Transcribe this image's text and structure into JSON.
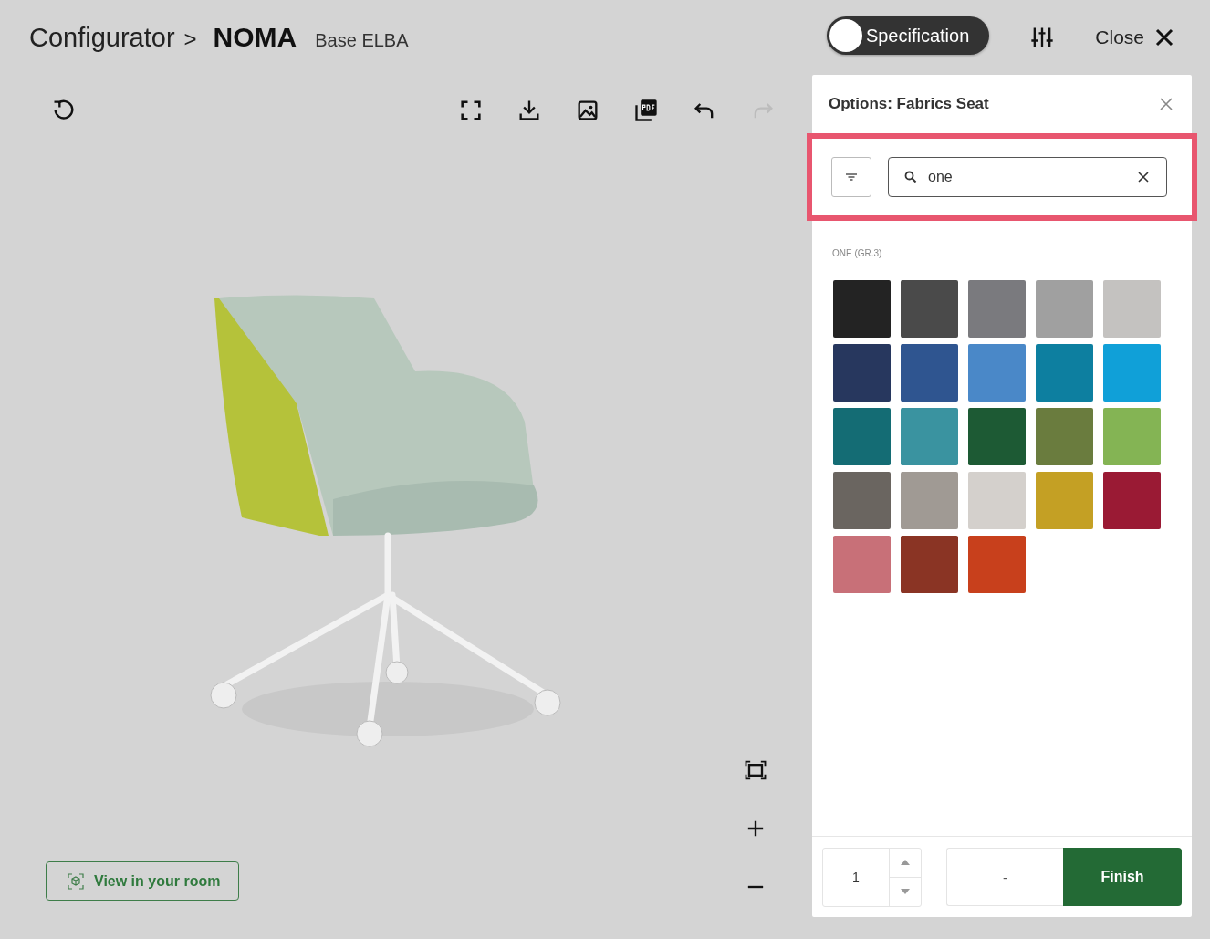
{
  "breadcrumb": {
    "root": "Configurator",
    "separator": ">",
    "product": "NOMA",
    "variant": "Base ELBA"
  },
  "header_actions": {
    "specification_toggle": {
      "label": "Specification",
      "on": false
    },
    "close_label": "Close"
  },
  "viewer_toolbar": [
    {
      "kind": "fullscreen",
      "disabled": false
    },
    {
      "kind": "download",
      "disabled": false
    },
    {
      "kind": "image",
      "disabled": false
    },
    {
      "kind": "pdf",
      "disabled": false
    },
    {
      "kind": "undo",
      "disabled": false
    },
    {
      "kind": "redo",
      "disabled": true
    }
  ],
  "view_in_room": "View in your room",
  "zoom_controls": [
    {
      "kind": "fit"
    },
    {
      "kind": "plus"
    },
    {
      "kind": "minus"
    }
  ],
  "panel": {
    "title": "Options: Fabrics Seat",
    "search": {
      "value": "one"
    },
    "group_label": "ONE (GR.3)",
    "swatches": [
      {
        "color": "#232323"
      },
      {
        "color": "#4a4a4a"
      },
      {
        "color": "#7a7a7e"
      },
      {
        "color": "#a0a0a0"
      },
      {
        "color": "#c4c2c0"
      },
      {
        "color": "#27375e"
      },
      {
        "color": "#2f5590"
      },
      {
        "color": "#4a88c8"
      },
      {
        "color": "#0d7fa0"
      },
      {
        "color": "#10a0d8"
      },
      {
        "color": "#146c74"
      },
      {
        "color": "#3a93a0"
      },
      {
        "color": "#1d5a34"
      },
      {
        "color": "#6a7c3e"
      },
      {
        "color": "#84b454"
      },
      {
        "color": "#6a6560"
      },
      {
        "color": "#a09a94"
      },
      {
        "color": "#d4d0cc"
      },
      {
        "color": "#c4a024"
      },
      {
        "color": "#9a1a34"
      },
      {
        "color": "#c87078"
      },
      {
        "color": "#8a3424"
      },
      {
        "color": "#c8401c"
      }
    ],
    "quantity": "1",
    "price": "-",
    "finish": "Finish"
  }
}
